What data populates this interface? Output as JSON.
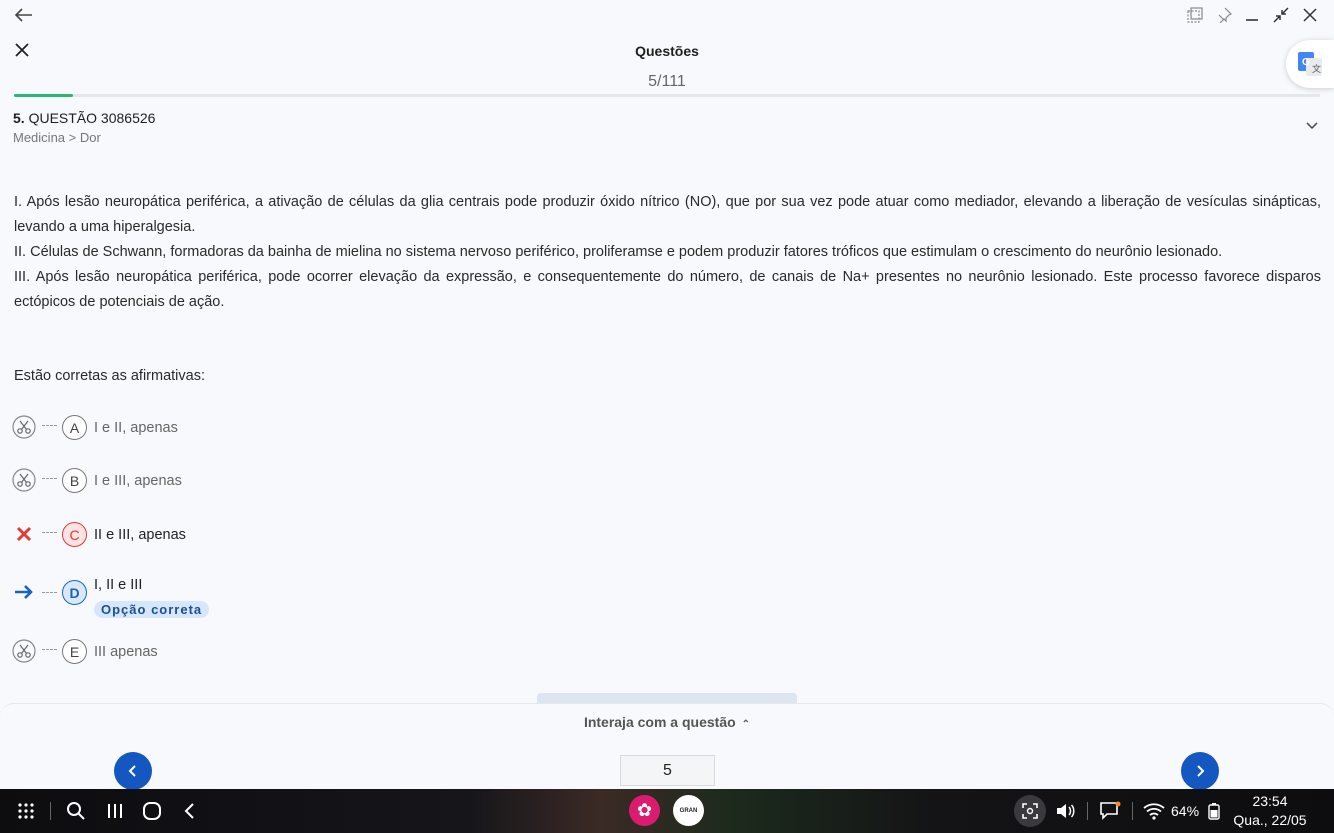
{
  "window": {
    "back_icon": "arrow-left-icon",
    "controls": [
      "snap-icon",
      "pin-icon",
      "minimize-icon",
      "restore-icon",
      "close-icon"
    ]
  },
  "header": {
    "title": "Questões",
    "counter": "5/111",
    "progress_fraction": 0.045
  },
  "question": {
    "number": "5.",
    "label": "QUESTÃO 3086526",
    "category": "Medicina > Dor",
    "statements": [
      "I. Após lesão neuropática periférica, a ativação de células da glia centrais pode produzir óxido nítrico (NO), que por sua vez pode atuar como mediador, elevando a liberação de vesículas sinápticas, levando a uma hiperalgesia.",
      "II. Células de Schwann, formadoras da bainha de mielina no sistema nervoso periférico, proliferamse e podem produzir fatores tróficos que estimulam o crescimento do neurônio lesionado.",
      "III. Após lesão neuropática periférica, pode ocorrer elevação da expressão, e consequentemente do número, de canais de Na+ presentes no neurônio lesionado. Este processo favorece disparos ectópicos de potenciais de ação."
    ],
    "prompt": "Estão corretas as afirmativas:",
    "options": [
      {
        "letter": "A",
        "text": "I e II, apenas",
        "state": "neutral"
      },
      {
        "letter": "B",
        "text": "I e III, apenas",
        "state": "neutral"
      },
      {
        "letter": "C",
        "text": "II e III, apenas",
        "state": "wrong"
      },
      {
        "letter": "D",
        "text": "I, II e III",
        "state": "correct",
        "badge": "Opção correta"
      },
      {
        "letter": "E",
        "text": "III apenas",
        "state": "neutral"
      }
    ]
  },
  "bottom": {
    "interact_label": "Interaja com a questão",
    "page_value": "5"
  },
  "taskbar": {
    "battery": "64%",
    "time": "23:54",
    "date": "Qua., 22/05",
    "app2_label": "GRAN"
  },
  "colors": {
    "accent_blue": "#1457c0",
    "progress_green": "#2bb673",
    "wrong_red": "#e53935"
  }
}
